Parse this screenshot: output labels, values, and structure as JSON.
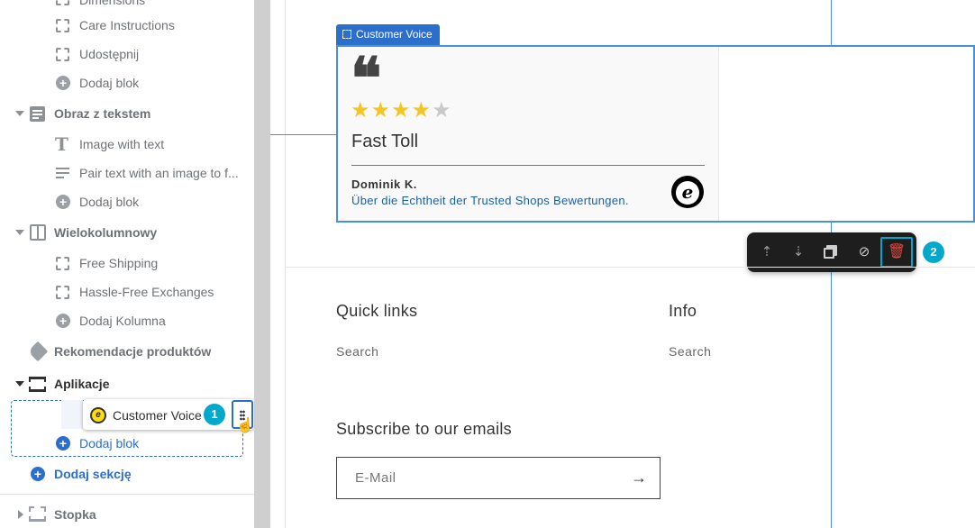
{
  "sidebar": {
    "items": [
      {
        "label": "Dimensions",
        "icon": "dashed-square-icon"
      },
      {
        "label": "Care Instructions",
        "icon": "dashed-square-icon"
      },
      {
        "label": "Udostępnij",
        "icon": "dashed-square-icon"
      },
      {
        "label": "Dodaj blok",
        "icon": "plus-circle-icon"
      },
      {
        "label": "Obraz z tekstem",
        "icon": "text-block-icon"
      },
      {
        "label": "Image with text",
        "icon": "text-t-icon"
      },
      {
        "label": "Pair text with an image to f...",
        "icon": "paragraph-icon"
      },
      {
        "label": "Dodaj blok",
        "icon": "plus-circle-icon"
      },
      {
        "label": "Wielokolumnowy",
        "icon": "columns-icon"
      },
      {
        "label": "Free Shipping",
        "icon": "dashed-square-icon"
      },
      {
        "label": "Hassle-Free Exchanges",
        "icon": "dashed-square-icon"
      },
      {
        "label": "Dodaj Kolumna",
        "icon": "plus-circle-icon"
      },
      {
        "label": "Rekomendacje produktów",
        "icon": "tag-icon"
      },
      {
        "label": "Aplikacje",
        "icon": "apps-section-icon"
      },
      {
        "label": "Customer Voice",
        "icon": "trusted-shops-icon"
      },
      {
        "label": "Dodaj blok",
        "icon": "plus-circle-icon"
      },
      {
        "label": "Dodaj sekcję",
        "icon": "plus-circle-icon"
      },
      {
        "label": "Stopka",
        "icon": "footer-icon"
      }
    ],
    "badge_1": "1"
  },
  "widget": {
    "tag_label": "Customer Voice",
    "quote_mark": "❝",
    "stars_rating": 4,
    "stars_total": 5,
    "review_title": "Fast Toll",
    "author": "Dominik K.",
    "link_text": "Über die Echtheit der Trusted Shops Bewertungen.",
    "logo_letter": "e"
  },
  "toolbar": {
    "buttons": [
      "move-up-icon",
      "move-down-icon",
      "duplicate-icon",
      "hide-icon",
      "delete-icon"
    ],
    "badge_2": "2"
  },
  "footer": {
    "quick_links_heading": "Quick links",
    "quick_links_item": "Search",
    "info_heading": "Info",
    "info_item": "Search",
    "subscribe_heading": "Subscribe to our emails",
    "email_placeholder": "E-Mail",
    "arrow": "→"
  },
  "colors": {
    "accent": "#2c6ecb",
    "badge": "#00a8cc",
    "star": "#f4c625",
    "delete": "#e0483e"
  }
}
